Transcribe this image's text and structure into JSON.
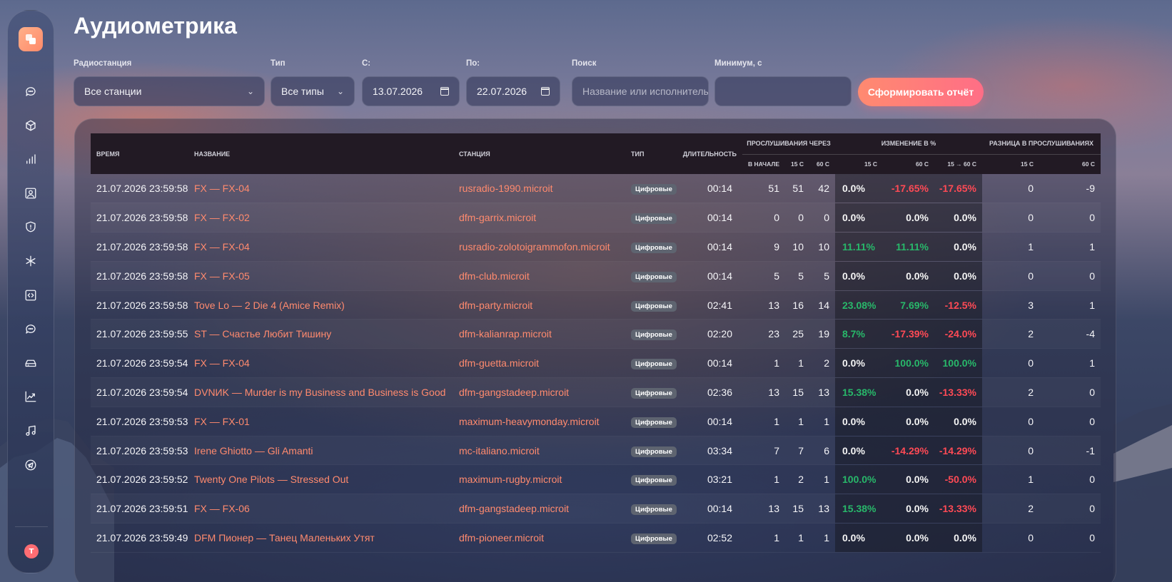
{
  "page": {
    "title": "Аудиометрика"
  },
  "sidebar": {
    "logo_icon": "app-logo-icon",
    "items": [
      {
        "icon": "chat-icon"
      },
      {
        "icon": "cube-icon"
      },
      {
        "icon": "bar-chart-icon"
      },
      {
        "icon": "user-card-icon"
      },
      {
        "icon": "shield-icon"
      },
      {
        "icon": "asterisk-icon"
      },
      {
        "icon": "code-icon"
      },
      {
        "icon": "message-icon"
      },
      {
        "icon": "drive-icon"
      },
      {
        "icon": "trend-icon"
      },
      {
        "icon": "music-icon"
      },
      {
        "icon": "telegram-icon"
      }
    ],
    "avatar_letter": "T"
  },
  "filters": {
    "station": {
      "label": "Радиостанция",
      "value": "Все станции"
    },
    "type": {
      "label": "Тип",
      "value": "Все типы"
    },
    "from": {
      "label": "С:",
      "value": "13.07.2026"
    },
    "to": {
      "label": "По:",
      "value": "22.07.2026"
    },
    "search": {
      "label": "Поиск",
      "placeholder": "Название или исполнитель"
    },
    "minimum": {
      "label": "Минимум, с",
      "value": ""
    },
    "submit_label": "Сформировать отчёт"
  },
  "table": {
    "headers": {
      "time": "Время",
      "name": "Название",
      "station": "Станция",
      "type": "Тип",
      "duration": "Длительность",
      "listens_group": "Прослушивания через",
      "change_group": "Изменение в %",
      "diff_group": "Разница в прослушиваниях",
      "start": "в начале",
      "s15": "15 с",
      "s60": "60 с",
      "p15": "15 с",
      "p60": "60 с",
      "p15_60": "15 → 60 с",
      "d15": "15 с",
      "d60": "60 с"
    },
    "rows": [
      {
        "time": "21.07.2026 23:59:58",
        "name": "FX — FX-04",
        "station": "rusradio-1990.microit",
        "type": "Цифровые",
        "duration": "00:14",
        "start": "51",
        "s15": "51",
        "s60": "42",
        "p15": "0.0%",
        "p60": "-17.65%",
        "p1560": "-17.65%",
        "d15": "0",
        "d60": "-9"
      },
      {
        "time": "21.07.2026 23:59:58",
        "name": "FX — FX-02",
        "station": "dfm-garrix.microit",
        "type": "Цифровые",
        "duration": "00:14",
        "start": "0",
        "s15": "0",
        "s60": "0",
        "p15": "0.0%",
        "p60": "0.0%",
        "p1560": "0.0%",
        "d15": "0",
        "d60": "0"
      },
      {
        "time": "21.07.2026 23:59:58",
        "name": "FX — FX-04",
        "station": "rusradio-zolotoigrammofon.microit",
        "type": "Цифровые",
        "duration": "00:14",
        "start": "9",
        "s15": "10",
        "s60": "10",
        "p15": "11.11%",
        "p60": "11.11%",
        "p1560": "0.0%",
        "d15": "1",
        "d60": "1"
      },
      {
        "time": "21.07.2026 23:59:58",
        "name": "FX — FX-05",
        "station": "dfm-club.microit",
        "type": "Цифровые",
        "duration": "00:14",
        "start": "5",
        "s15": "5",
        "s60": "5",
        "p15": "0.0%",
        "p60": "0.0%",
        "p1560": "0.0%",
        "d15": "0",
        "d60": "0"
      },
      {
        "time": "21.07.2026 23:59:58",
        "name": "Tove Lo — 2 Die 4 (Amice Remix)",
        "station": "dfm-party.microit",
        "type": "Цифровые",
        "duration": "02:41",
        "start": "13",
        "s15": "16",
        "s60": "14",
        "p15": "23.08%",
        "p60": "7.69%",
        "p1560": "-12.5%",
        "d15": "3",
        "d60": "1"
      },
      {
        "time": "21.07.2026 23:59:55",
        "name": "ST — Счастье Любит Тишину",
        "station": "dfm-kalianrap.microit",
        "type": "Цифровые",
        "duration": "02:20",
        "start": "23",
        "s15": "25",
        "s60": "19",
        "p15": "8.7%",
        "p60": "-17.39%",
        "p1560": "-24.0%",
        "d15": "2",
        "d60": "-4"
      },
      {
        "time": "21.07.2026 23:59:54",
        "name": "FX — FX-04",
        "station": "dfm-guetta.microit",
        "type": "Цифровые",
        "duration": "00:14",
        "start": "1",
        "s15": "1",
        "s60": "2",
        "p15": "0.0%",
        "p60": "100.0%",
        "p1560": "100.0%",
        "d15": "0",
        "d60": "1"
      },
      {
        "time": "21.07.2026 23:59:54",
        "name": "DVNИK — Murder is my Business and Business is Good",
        "station": "dfm-gangstadeep.microit",
        "type": "Цифровые",
        "duration": "02:36",
        "start": "13",
        "s15": "15",
        "s60": "13",
        "p15": "15.38%",
        "p60": "0.0%",
        "p1560": "-13.33%",
        "d15": "2",
        "d60": "0"
      },
      {
        "time": "21.07.2026 23:59:53",
        "name": "FX — FX-01",
        "station": "maximum-heavymonday.microit",
        "type": "Цифровые",
        "duration": "00:14",
        "start": "1",
        "s15": "1",
        "s60": "1",
        "p15": "0.0%",
        "p60": "0.0%",
        "p1560": "0.0%",
        "d15": "0",
        "d60": "0"
      },
      {
        "time": "21.07.2026 23:59:53",
        "name": "Irene Ghiotto — Gli Amanti",
        "station": "mc-italiano.microit",
        "type": "Цифровые",
        "duration": "03:34",
        "start": "7",
        "s15": "7",
        "s60": "6",
        "p15": "0.0%",
        "p60": "-14.29%",
        "p1560": "-14.29%",
        "d15": "0",
        "d60": "-1"
      },
      {
        "time": "21.07.2026 23:59:52",
        "name": "Twenty One Pilots — Stressed Out",
        "station": "maximum-rugby.microit",
        "type": "Цифровые",
        "duration": "03:21",
        "start": "1",
        "s15": "2",
        "s60": "1",
        "p15": "100.0%",
        "p60": "0.0%",
        "p1560": "-50.0%",
        "d15": "1",
        "d60": "0"
      },
      {
        "time": "21.07.2026 23:59:51",
        "name": "FX — FX-06",
        "station": "dfm-gangstadeep.microit",
        "type": "Цифровые",
        "duration": "00:14",
        "start": "13",
        "s15": "15",
        "s60": "13",
        "p15": "15.38%",
        "p60": "0.0%",
        "p1560": "-13.33%",
        "d15": "2",
        "d60": "0"
      },
      {
        "time": "21.07.2026 23:59:49",
        "name": "DFM Пионер — Танец Маленьких Утят",
        "station": "dfm-pioneer.microit",
        "type": "Цифровые",
        "duration": "02:52",
        "start": "1",
        "s15": "1",
        "s60": "1",
        "p15": "0.0%",
        "p60": "0.0%",
        "p1560": "0.0%",
        "d15": "0",
        "d60": "0"
      }
    ]
  },
  "colors": {
    "positive": "#28b86a",
    "negative": "#ff4a55",
    "accent": "#ff8a6e"
  }
}
